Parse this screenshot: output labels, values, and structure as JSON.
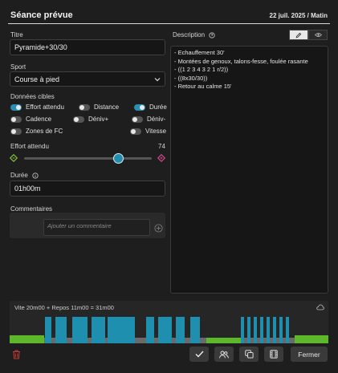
{
  "header": {
    "title": "Séance prévue",
    "date": "22 juil. 2025 / Matin"
  },
  "fields": {
    "title_label": "Titre",
    "title_value": "Pyramide+30/30",
    "sport_label": "Sport",
    "sport_value": "Course à pied",
    "targets_label": "Données cibles"
  },
  "toggles": [
    {
      "label": "Effort attendu",
      "on": true
    },
    {
      "label": "Distance",
      "on": false
    },
    {
      "label": "Durée",
      "on": true
    },
    {
      "label": "Cadence",
      "on": false
    },
    {
      "label": "Déniv+",
      "on": false
    },
    {
      "label": "Déniv-",
      "on": false
    },
    {
      "label": "Zones de FC",
      "on": false
    },
    {
      "label": "Vitesse",
      "on": false
    }
  ],
  "effort": {
    "label": "Effort attendu",
    "value": "74",
    "level": 74
  },
  "duration": {
    "label": "Durée",
    "value": "01h00m"
  },
  "comments": {
    "label": "Commentaires",
    "placeholder": "Ajouter un commentaire"
  },
  "description": {
    "label": "Description",
    "lines": [
      "- Echauffement 30'",
      "- Montées de genoux, talons-fesse, foulée rasante",
      "- ((1 2 3 4 3 2 1 r/2))",
      "- ((8x30/30))",
      "- Retour au calme 15'"
    ]
  },
  "workout": {
    "summary": "Vite 20m00 + Repos 11m00 = 31m00"
  },
  "footer": {
    "close_label": "Fermer"
  },
  "colors": {
    "accent": "#2a8fb0",
    "green": "#5cb82a",
    "bar": "#1f8fb0",
    "danger": "#c43a3a"
  }
}
